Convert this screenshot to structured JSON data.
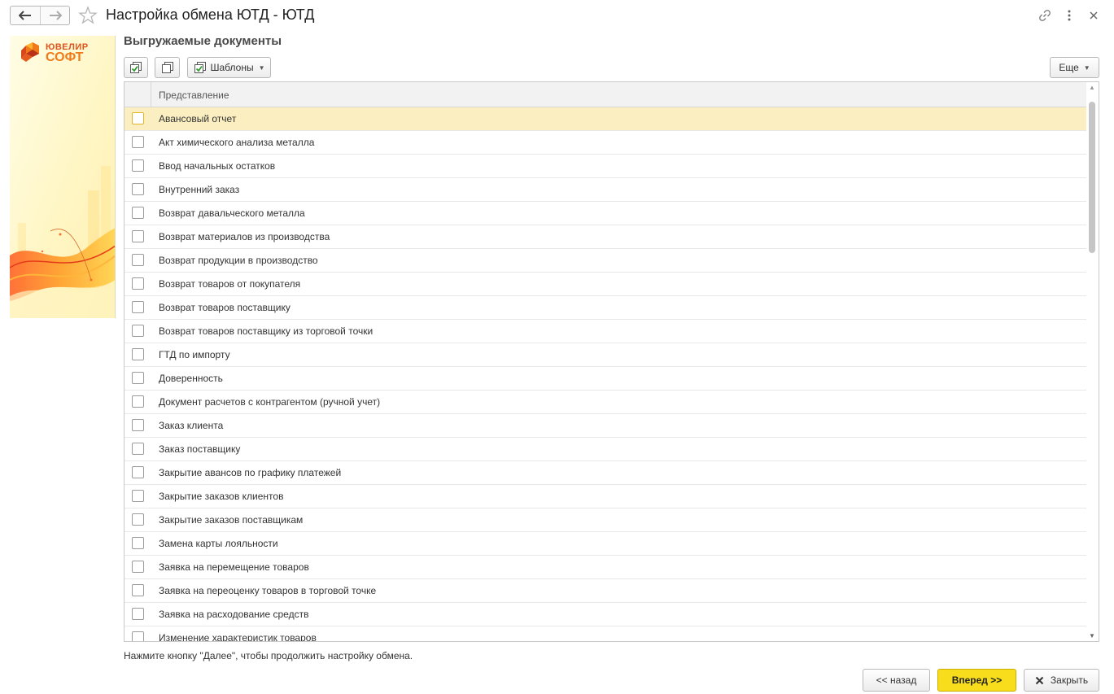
{
  "window": {
    "title": "Настройка обмена ЮТД - ЮТД"
  },
  "logo": {
    "line1": "ЮВЕЛИР",
    "line2": "СОФТ"
  },
  "form": {
    "title": "Выгружаемые документы"
  },
  "toolbar": {
    "templates_label": "Шаблоны",
    "more_label": "Еще"
  },
  "table": {
    "column_header": "Представление",
    "selected_row_index": 0,
    "rows": [
      "Авансовый отчет",
      "Акт химического анализа металла",
      "Ввод начальных остатков",
      "Внутренний заказ",
      "Возврат давальческого металла",
      "Возврат материалов из производства",
      "Возврат продукции в производство",
      "Возврат товаров от покупателя",
      "Возврат товаров поставщику",
      "Возврат товаров поставщику из торговой точки",
      "ГТД по импорту",
      "Доверенность",
      "Документ расчетов с контрагентом (ручной учет)",
      "Заказ клиента",
      "Заказ поставщику",
      "Закрытие авансов по графику платежей",
      "Закрытие заказов клиентов",
      "Закрытие заказов поставщикам",
      "Замена карты лояльности",
      "Заявка на перемещение товаров",
      "Заявка на переоценку товаров в торговой точке",
      "Заявка на расходование средств",
      "Изменение характеристик товаров"
    ]
  },
  "footer": {
    "hint": "Нажмите кнопку \"Далее\", чтобы продолжить настройку обмена.",
    "back_label": "<< назад",
    "next_label": "Вперед >>",
    "close_label": "Закрыть"
  },
  "colors": {
    "selected_row": "#fbeec0",
    "primary_button": "#f7dd1c",
    "logo_orange": "#f07a1a"
  }
}
